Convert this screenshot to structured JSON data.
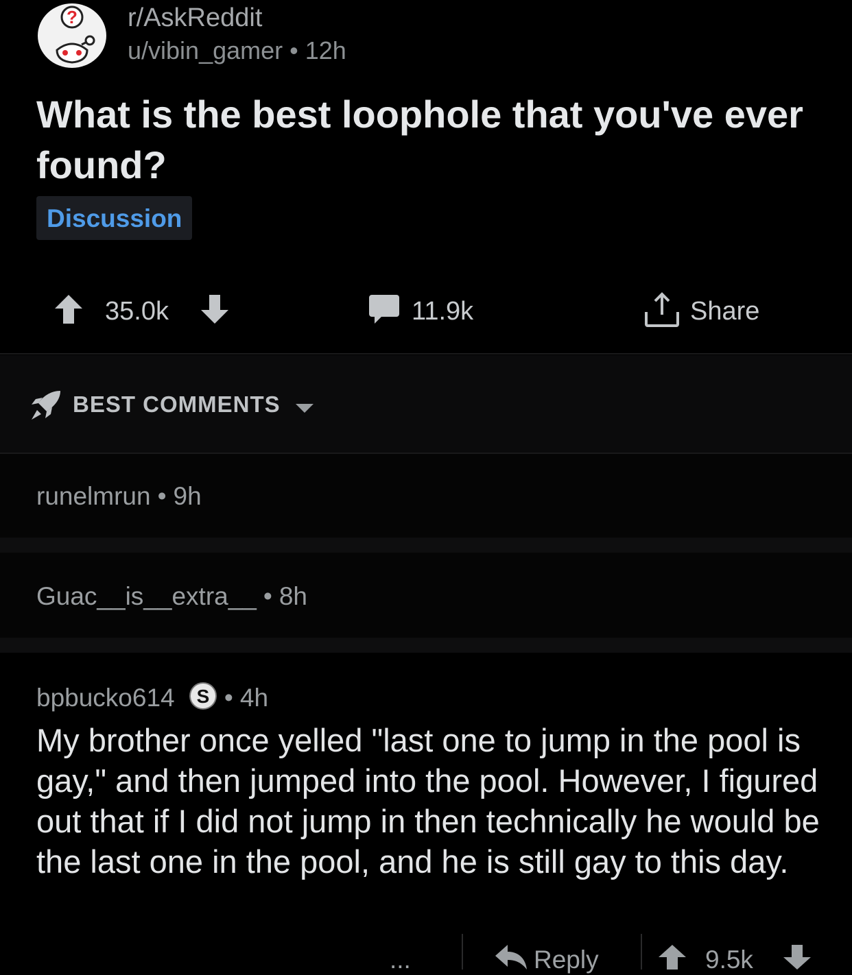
{
  "post": {
    "subreddit": "r/AskReddit",
    "author": "u/vibin_gamer",
    "age": "12h",
    "title": "What is the best loophole that you've ever found?",
    "flair": "Discussion",
    "score": "35.0k",
    "comment_count": "11.9k",
    "share_label": "Share"
  },
  "sort": {
    "label": "BEST COMMENTS"
  },
  "comments": [
    {
      "author": "runelmrun",
      "age": "9h",
      "collapsed": true
    },
    {
      "author": "Guac__is__extra__",
      "age": "8h",
      "collapsed": true
    },
    {
      "author": "bpbucko614",
      "badge": "S",
      "age": "4h",
      "body": "My brother once yelled \"last one to jump in the pool is gay,\" and then jumped into the pool. However, I figured out that if I did not jump in then technically he would be the last one in the pool, and he is still gay to this day.",
      "reply_label": "Reply",
      "score": "9.5k",
      "more_label": "..."
    }
  ],
  "icons": {
    "avatar": "askreddit-snoo-icon",
    "upvote": "upvote-arrow-icon",
    "downvote": "downvote-arrow-icon",
    "comment": "comment-bubble-icon",
    "share": "share-upload-icon",
    "sort": "rocket-icon",
    "reply": "reply-arrow-icon",
    "badge": "s-badge-icon"
  }
}
